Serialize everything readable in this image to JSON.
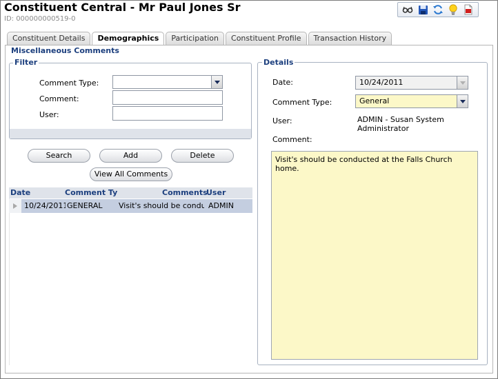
{
  "header": {
    "title": "Constituent Central - Mr Paul Jones Sr",
    "id_text": "ID: 000000000519-0"
  },
  "toolbar": {
    "icons": [
      "glasses-icon",
      "save-icon",
      "refresh-icon",
      "lightbulb-icon",
      "pdf-report-icon"
    ]
  },
  "tabs": [
    {
      "label": "Constituent Details",
      "active": false
    },
    {
      "label": "Demographics",
      "active": true
    },
    {
      "label": "Participation",
      "active": false
    },
    {
      "label": "Constituent Profile",
      "active": false
    },
    {
      "label": "Transaction History",
      "active": false
    }
  ],
  "section": {
    "title": "Miscellaneous Comments"
  },
  "filter": {
    "title": "Filter",
    "comment_type_label": "Comment Type:",
    "comment_type_value": "",
    "comment_label": "Comment:",
    "comment_value": "",
    "user_label": "User:",
    "user_value": ""
  },
  "buttons": {
    "search": "Search",
    "add": "Add",
    "delete": "Delete",
    "view_all": "View All Comments"
  },
  "grid": {
    "columns": [
      "Date",
      "Comment Ty",
      "Comments",
      "User"
    ],
    "rows": [
      {
        "date": "10/24/2011",
        "type": "GENERAL",
        "comment": "Visit's should be conducted at the Falls Church home.",
        "user": "ADMIN"
      }
    ]
  },
  "details": {
    "title": "Details",
    "date_label": "Date:",
    "date_value": "10/24/2011",
    "comment_type_label": "Comment Type:",
    "comment_type_value": "General",
    "user_label": "User:",
    "user_value": "ADMIN - Susan System Administrator",
    "comment_label": "Comment:",
    "comment_value": "Visit's should be conducted at the Falls Church home."
  },
  "colors": {
    "section_title": "#1c3f7e",
    "selected_row": "#c4cee0",
    "highlight_field": "#fcf8c8"
  }
}
